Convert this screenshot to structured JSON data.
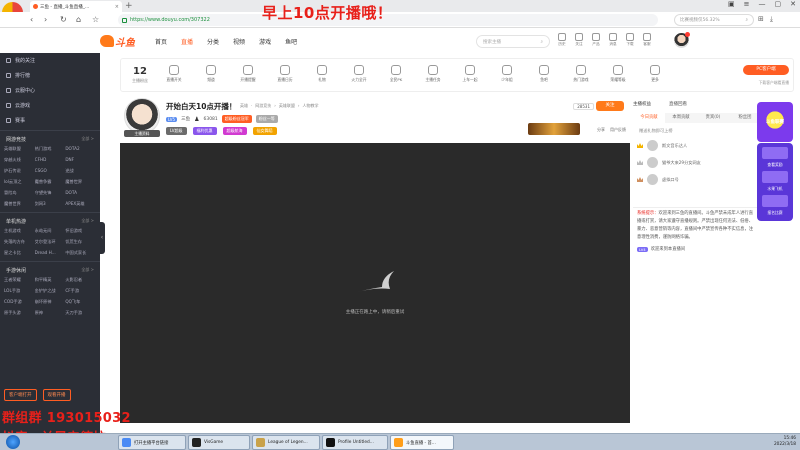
{
  "browser": {
    "badge": "谷歌浏览器",
    "tab_title": "三鱼 - 直播_斗鱼直播_...",
    "new_tab": "+",
    "url": "https://www.douyu.com/307322",
    "search_placeholder": "比赛视频仅56.32%",
    "overlay_banner": "早上10点开播哦！"
  },
  "header": {
    "nav": [
      "首页",
      "直播",
      "分类",
      "视频",
      "游戏",
      "鱼吧"
    ],
    "active_nav": "直播",
    "search_placeholder": "搜索主播",
    "icons": [
      "历史",
      "关注",
      "产品",
      "消息",
      "下载",
      "客服",
      "我"
    ]
  },
  "sidebar": {
    "items": [
      {
        "label": "我的关注"
      },
      {
        "label": "排行榜"
      },
      {
        "label": "云服中心"
      },
      {
        "label": "云游戏"
      },
      {
        "label": "赛事"
      }
    ],
    "sections": [
      {
        "title": "网游竞技",
        "more": "全部 >",
        "cells": [
          "英雄联盟",
          "热门游戏",
          "DOTA2",
          "穿越火线",
          "CFHD",
          "DNF",
          "炉石传说",
          "CSGO",
          "逆战",
          "lol云顶之",
          "魔兽争霸",
          "魔兽世界",
          "冒险岛",
          "守望先锋",
          "DOTA",
          "魔兽世界",
          "剑网3",
          "APEX英雄"
        ]
      },
      {
        "title": "单机热游",
        "more": "全部 >",
        "cells": [
          "主机游戏",
          "永劫无间",
          "怀旧游戏",
          "失落的方舟",
          "艾尔登法环",
          "饥荒生存",
          "星之卡比",
          "Dread H...",
          "中国式家长"
        ]
      },
      {
        "title": "手游休闲",
        "more": "全部 >",
        "cells": [
          "王者荣耀",
          "和平精英",
          "火影忍者",
          "LOL手游",
          "金铲铲之战",
          "CF手游",
          "COD手游",
          "崩坏原神",
          "QQ飞车",
          "原手头游",
          "原神",
          "天刀手游"
        ]
      }
    ],
    "bottom": [
      "客户端打开",
      "观看开播"
    ],
    "collapse": "‹"
  },
  "categories": {
    "count": "12",
    "count_label": "主播粉丝",
    "items": [
      "直播开关",
      "频道",
      "开播提醒",
      "直播日历",
      "礼物",
      "火力全开",
      "全民PK",
      "主播任务",
      "上车一起",
      "少年组",
      "鱼吧",
      "热门游戏",
      "荣耀等级",
      "更多"
    ],
    "pc_client": "PC客户端",
    "pc_note": "下载客户端看直播"
  },
  "room": {
    "title": "开始白天10点开播！",
    "meta": [
      "英雄",
      "网游竞技",
      "英雄联盟",
      "人物教学"
    ],
    "level": "LV5",
    "anchor_name": "三鱼",
    "fans": "63081",
    "pill1": "超级粉丝冠军",
    "pill2": "粉丝一等",
    "tag1": "LV超级",
    "tag2": "福利优惠",
    "tag3": "超级航海",
    "tag4": "仙女舞蹈",
    "hot": "28531",
    "follow": "关注",
    "share": [
      "分享",
      "用户反馈"
    ],
    "anchor_tag": "主播资料"
  },
  "video": {
    "message": "主播正在路上中，请稍后重试"
  },
  "right": {
    "heads": [
      "主播权益",
      "直播回看"
    ],
    "tabs": [
      "今日贡献",
      "本周贡献",
      "贵宾(0)",
      "粉丝团"
    ],
    "tip": "赠送礼物即可上榜",
    "rank": [
      {
        "name": "斯文音乐达人"
      },
      {
        "name": "猫爷大来29分女网友"
      },
      {
        "name": "虚拟口号"
      }
    ],
    "system_label": "系统提示：",
    "system_msg": "欢迎来到三鱼的直播间。斗鱼严禁未成年人进行直播或打赏，请大家遵守直播规则。严禁出现任何违法、低俗、暴力、恶意营销等内容，直播间中严禁宣传各种不实信息，注意理性消费，谨防网络诈骗。",
    "welcome_level": "LV4",
    "welcome_msg": "欢迎来到本直播间",
    "promo_top": "斗鱼联赛",
    "promo_texts": [
      "查看奖励",
      "水果飞机",
      "报名比赛"
    ]
  },
  "overlay": {
    "id_text": "群组群 193015032",
    "douyin_text": "抖音：兰晨辛德拉"
  },
  "taskbar": {
    "tasks": [
      "打开主播平台链接",
      "VisGame",
      "League of Legen...",
      "Profile Untitled...",
      "斗鱼直播 - 首..."
    ],
    "time": "15:46",
    "date": "2022/3/18"
  }
}
